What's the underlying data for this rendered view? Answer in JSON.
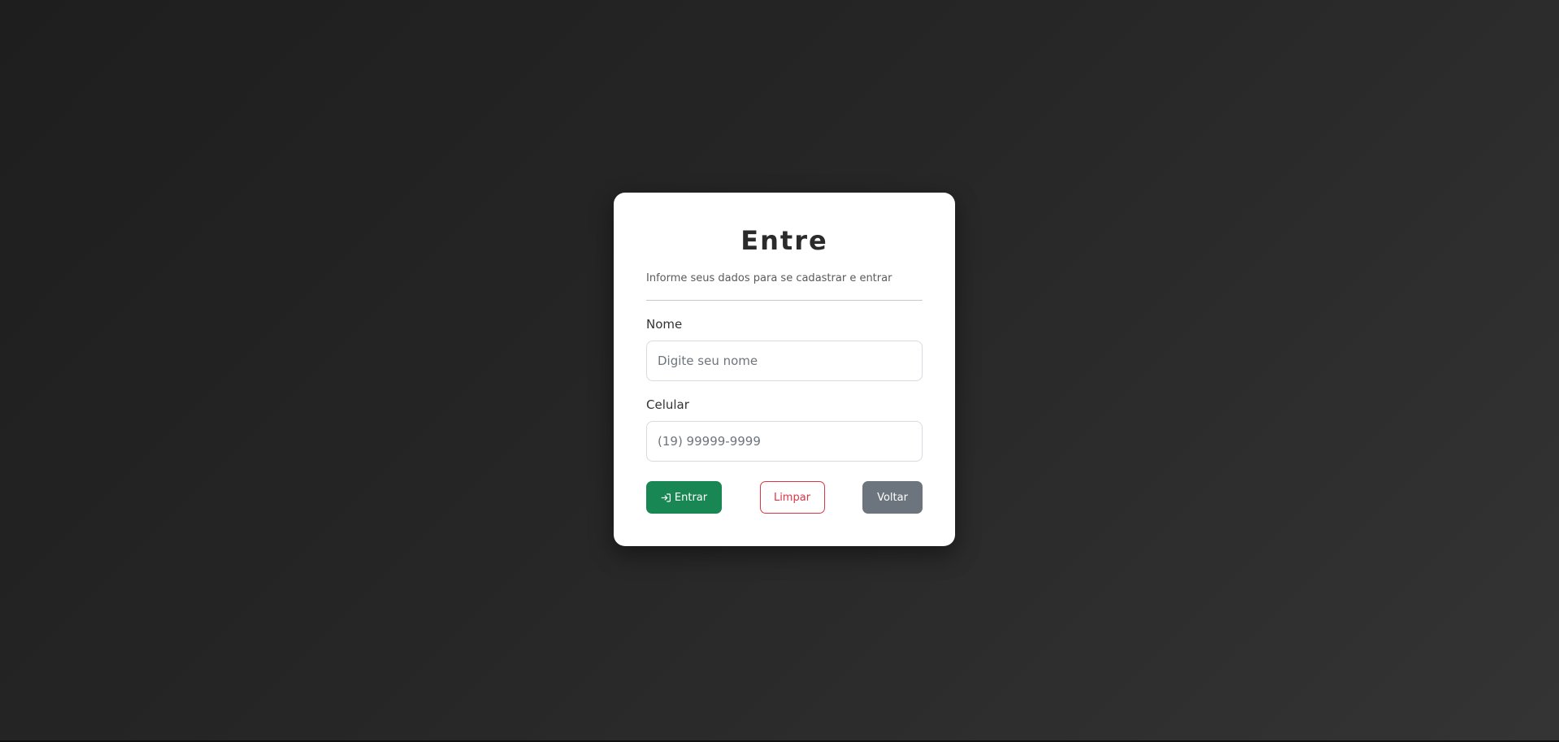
{
  "form": {
    "title": "Entre",
    "subtitle": "Informe seus dados para se cadastrar e entrar",
    "fields": {
      "nome": {
        "label": "Nome",
        "value": "",
        "placeholder": "Digite seu nome"
      },
      "celular": {
        "label": "Celular",
        "value": "",
        "placeholder": "(19) 99999-9999"
      }
    },
    "buttons": {
      "enter": {
        "label": "Entrar",
        "icon": "login-icon"
      },
      "clear": {
        "label": "Limpar"
      },
      "back": {
        "label": "Voltar"
      }
    }
  },
  "colors": {
    "success": "#198754",
    "danger": "#dc3545",
    "secondary": "#6c757d"
  }
}
